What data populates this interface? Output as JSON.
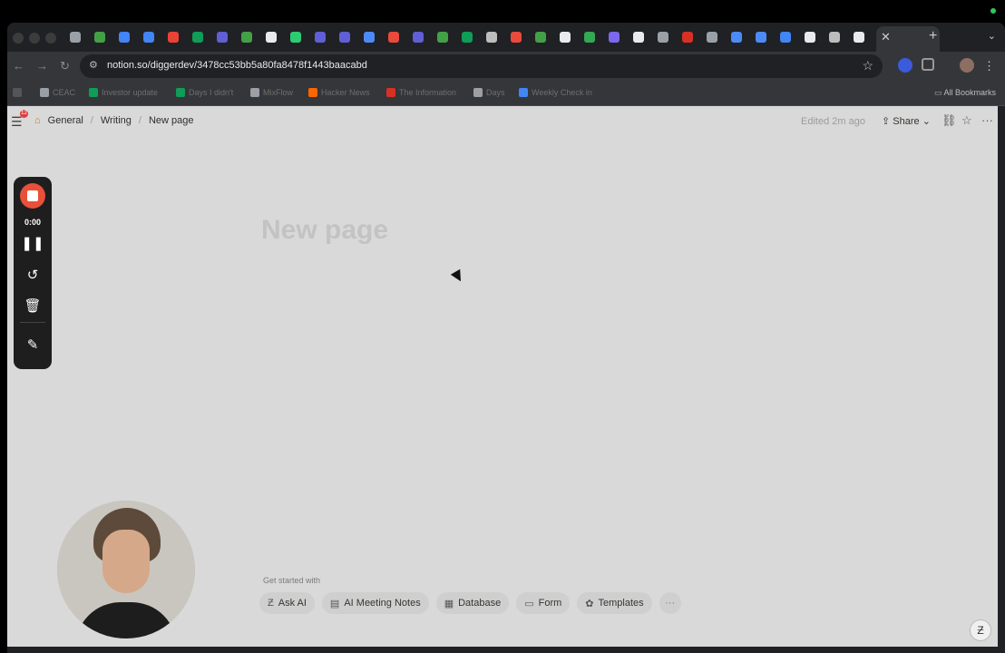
{
  "browser": {
    "url": "notion.so/diggerdev/3478cc53bb5a80fa8478f1443baacabd",
    "tab_icons": [
      {
        "name": "notion-tab-icon",
        "color": "#9aa0a6"
      },
      {
        "name": "ppm-tab-icon",
        "color": "#43a047"
      },
      {
        "name": "meet-tab-icon",
        "color": "#4285f4"
      },
      {
        "name": "meet-tab-icon",
        "color": "#4285f4"
      },
      {
        "name": "gmail-tab-icon",
        "color": "#ea4335"
      },
      {
        "name": "sheets-tab-icon",
        "color": "#0f9d58"
      },
      {
        "name": "app-tab-icon",
        "color": "#5f5fd6"
      },
      {
        "name": "ppm-tab-icon",
        "color": "#43a047"
      },
      {
        "name": "github-tab-icon",
        "color": "#e8eaed"
      },
      {
        "name": "leaf-tab-icon",
        "color": "#2ecc71"
      },
      {
        "name": "app-tab-icon",
        "color": "#5f5fd6"
      },
      {
        "name": "app-tab-icon",
        "color": "#5f5fd6"
      },
      {
        "name": "translate-tab-icon",
        "color": "#4c8bf5"
      },
      {
        "name": "sparkle-tab-icon",
        "color": "#e84a3c"
      },
      {
        "name": "app-tab-icon",
        "color": "#5f5fd6"
      },
      {
        "name": "ppm-tab-icon",
        "color": "#43a047"
      },
      {
        "name": "sheets-tab-icon",
        "color": "#0f9d58"
      },
      {
        "name": "chatgpt-tab-icon",
        "color": "#bdbdbd"
      },
      {
        "name": "sparkle-tab-icon",
        "color": "#e84a3c"
      },
      {
        "name": "ppm-tab-icon",
        "color": "#43a047"
      },
      {
        "name": "github-tab-icon",
        "color": "#e8eaed"
      },
      {
        "name": "green-tab-icon",
        "color": "#34a853"
      },
      {
        "name": "linear-tab-icon",
        "color": "#7b68ee"
      },
      {
        "name": "github-tab-icon",
        "color": "#e8eaed"
      },
      {
        "name": "notion-tab-icon",
        "color": "#9aa0a6"
      },
      {
        "name": "red-tab-icon",
        "color": "#d93025"
      },
      {
        "name": "notion-tab-icon",
        "color": "#9aa0a6"
      },
      {
        "name": "translate-tab-icon",
        "color": "#4c8bf5"
      },
      {
        "name": "translate-tab-icon",
        "color": "#4c8bf5"
      },
      {
        "name": "docs-tab-icon",
        "color": "#4285f4"
      },
      {
        "name": "tab-o-icon",
        "color": "#e8eaed"
      },
      {
        "name": "chatgpt-tab-icon",
        "color": "#bdbdbd"
      },
      {
        "name": "x-tab-icon",
        "color": "#e8eaed"
      }
    ],
    "bookmarks": [
      {
        "label": "CEAC",
        "color": "#9aa0a6"
      },
      {
        "label": "Investor update",
        "color": "#0f9d58"
      },
      {
        "label": "Days I didn't",
        "color": "#0f9d58"
      },
      {
        "label": "MixFlow",
        "color": "#9aa0a6"
      },
      {
        "label": "Hacker News",
        "color": "#ff6600"
      },
      {
        "label": "The Information",
        "color": "#d93025"
      },
      {
        "label": "Days",
        "color": "#9aa0a6"
      },
      {
        "label": "Weekly Check in",
        "color": "#4285f4"
      }
    ],
    "all_bookmarks": "All Bookmarks"
  },
  "notion": {
    "breadcrumbs": [
      "General",
      "Writing",
      "New page"
    ],
    "notification_count": "12",
    "edited": "Edited 2m ago",
    "share_label": "Share",
    "page_title_placeholder": "New page",
    "get_started_label": "Get started with",
    "chips": [
      {
        "label": "Ask AI",
        "icon": "ai-icon",
        "glyph": "Ƶ"
      },
      {
        "label": "AI Meeting Notes",
        "icon": "notes-icon",
        "glyph": "▤"
      },
      {
        "label": "Database",
        "icon": "table-icon",
        "glyph": "▦"
      },
      {
        "label": "Form",
        "icon": "form-icon",
        "glyph": "▭"
      },
      {
        "label": "Templates",
        "icon": "templates-icon",
        "glyph": "✿"
      }
    ],
    "more_label": "···"
  },
  "recorder": {
    "time": "0:00"
  }
}
